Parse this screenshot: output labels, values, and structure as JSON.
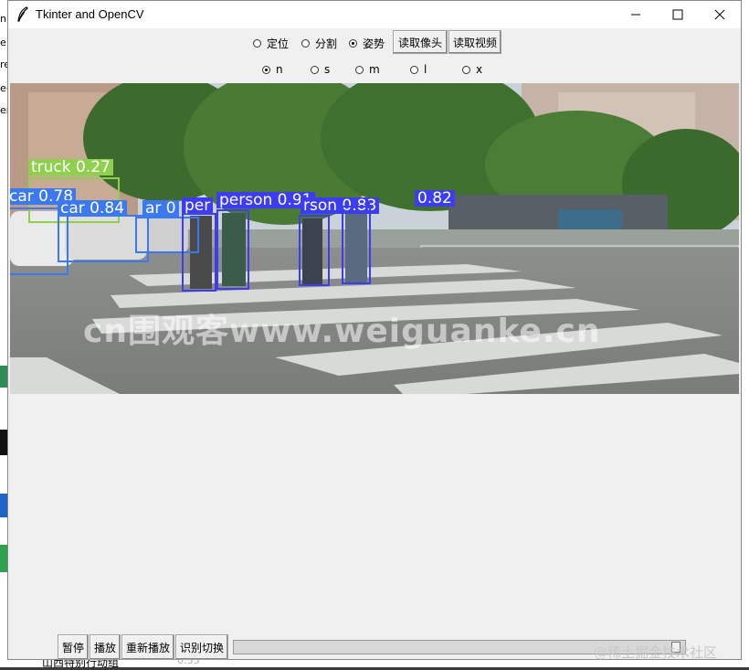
{
  "window": {
    "title": "Tkinter and OpenCV"
  },
  "modes": [
    {
      "label": "定位",
      "selected": false
    },
    {
      "label": "分割",
      "selected": false
    },
    {
      "label": "姿势",
      "selected": true
    }
  ],
  "top_buttons": {
    "camera": "读取像头",
    "video": "读取视频"
  },
  "models": [
    {
      "label": "n",
      "selected": true
    },
    {
      "label": "s",
      "selected": false
    },
    {
      "label": "m",
      "selected": false
    },
    {
      "label": "l",
      "selected": false
    },
    {
      "label": "x",
      "selected": false
    }
  ],
  "detections": [
    {
      "label": "truck 0.27",
      "color": "#8fd14f"
    },
    {
      "label": "car 0.78",
      "color": "#3c78f0"
    },
    {
      "label": "car 0.84",
      "color": "#3c78f0"
    },
    {
      "label": "ar 0",
      "color": "#3c78f0"
    },
    {
      "label": "per",
      "color": "#3c3cf0"
    },
    {
      "label": "person 0.91",
      "color": "#3c3cf0"
    },
    {
      "label": "rson 0.83",
      "color": "#3c3cf0"
    },
    {
      "label": "0.82",
      "color": "#3c3cf0"
    }
  ],
  "video_watermark": "cn围观客www.weiguanke.cn",
  "bottom_buttons": {
    "pause": "暂停",
    "play": "播放",
    "replay": "重新播放",
    "switch": "识别切换"
  },
  "progress": {
    "value": 0.99
  },
  "corner_watermark": "@稀土掘金技术社区",
  "background_app": {
    "left_fragments": [
      "n",
      "e",
      "re",
      "e-",
      "er"
    ],
    "bottom_text": "山西特别行动组",
    "bottom_duration": "0:55"
  },
  "colors": {
    "window_bg": "#f0f0f0",
    "person_box": "#3c3cf0",
    "car_box": "#3c78f0",
    "truck_box": "#8fd14f"
  }
}
